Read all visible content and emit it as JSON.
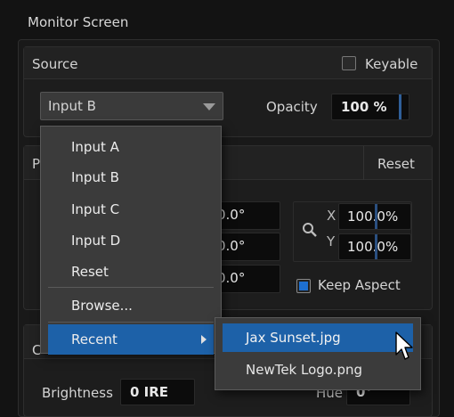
{
  "panel": {
    "title": "Monitor Screen"
  },
  "source": {
    "label": "Source",
    "keyable_label": "Keyable",
    "keyable_checked": false,
    "selected_input": "Input B",
    "opacity_label": "Opacity",
    "opacity_value": "100 %"
  },
  "dropdown": {
    "items": [
      "Input A",
      "Input B",
      "Input C",
      "Input D",
      "Reset"
    ],
    "browse": "Browse...",
    "recent": "Recent"
  },
  "recent_menu": {
    "items": [
      "Jax Sunset.jpg",
      "NewTek Logo.png"
    ]
  },
  "position": {
    "header_initial": "P",
    "reset_label": "Reset",
    "rotation_values": [
      "0.0°",
      "0.0°",
      "0.0°"
    ],
    "scale_x_label": "X",
    "scale_y_label": "Y",
    "scale_x": "100.0%",
    "scale_y": "100.0%",
    "keep_aspect_label": "Keep Aspect",
    "keep_aspect_checked": true
  },
  "color": {
    "header_initial": "C",
    "brightness_label": "Brightness",
    "brightness_value": "0 IRE",
    "hue_label": "Hue",
    "hue_value": "0°"
  },
  "colors": {
    "accent": "#1d61a8",
    "tick": "#2f5f99"
  }
}
